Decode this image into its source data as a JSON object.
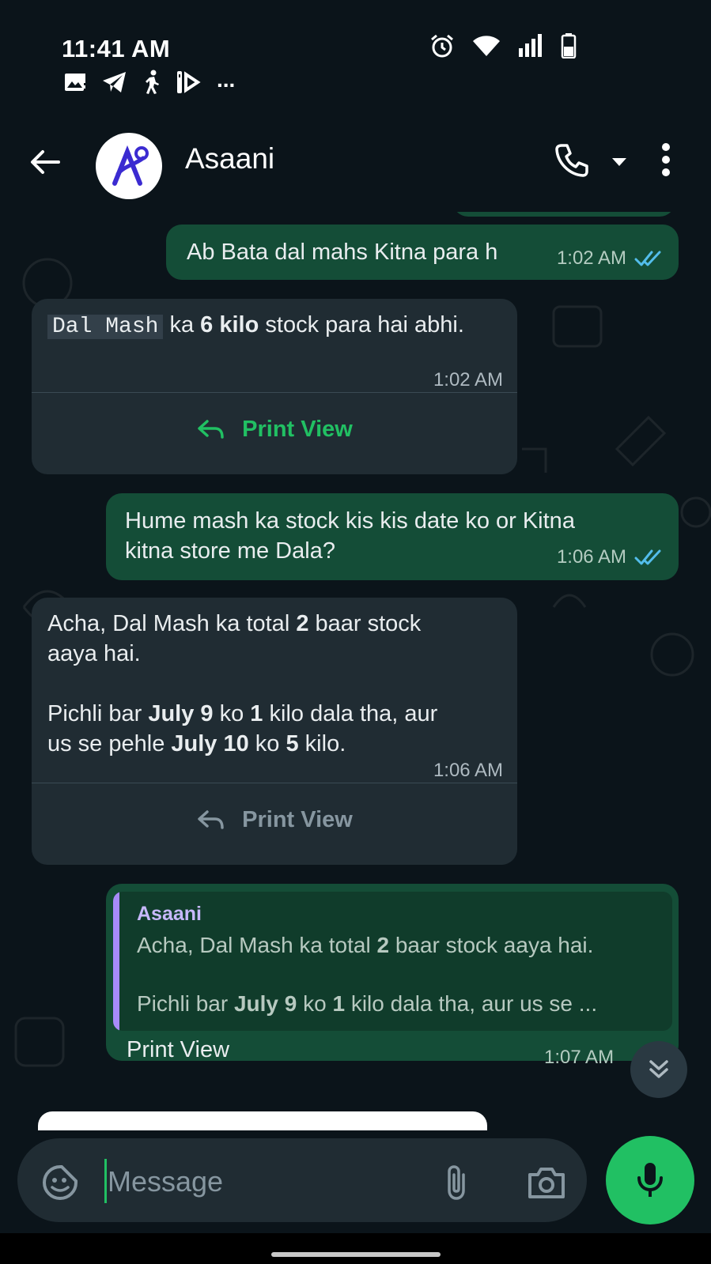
{
  "status_bar": {
    "time": "11:41 AM",
    "overflow_dots": "...",
    "notification_icons": [
      "image-icon",
      "telegram-icon",
      "walking-icon",
      "remote-icon"
    ],
    "system_icons": [
      "alarm-icon",
      "wifi-icon",
      "signal-icon",
      "battery-icon"
    ]
  },
  "header": {
    "title": "Asaani"
  },
  "messages": [
    {
      "direction": "outgoing",
      "text": "Ab Bata dal mahs Kitna para h",
      "time": "1:02 AM",
      "status": "read"
    },
    {
      "direction": "incoming",
      "code": "Dal Mash",
      "text_1": " ka ",
      "bold_1": "6 kilo",
      "text_2": " stock para hai abhi.",
      "time": "1:02 AM",
      "action": "Print View"
    },
    {
      "direction": "outgoing",
      "text_line_1": "Hume mash ka stock kis kis date ko or Kitna",
      "text_line_2": "kitna store me Dala?",
      "time": "1:06 AM",
      "status": "read"
    },
    {
      "direction": "incoming",
      "p1_a": "Acha, Dal Mash ka total ",
      "p1_b": "2",
      "p1_c": " baar stock",
      "p1_d": "aaya hai.",
      "p2_a": "Pichli bar ",
      "p2_b": "July 9",
      "p2_c": " ko ",
      "p2_d": "1",
      "p2_e": " kilo dala tha, aur",
      "p2_f": "us se pehle ",
      "p2_g": "July 10",
      "p2_h": " ko ",
      "p2_i": "5",
      "p2_j": " kilo.",
      "time": "1:06 AM",
      "action": "Print View"
    },
    {
      "direction": "outgoing",
      "quote_author": "Asaani",
      "q1_a": "Acha, Dal Mash ka total ",
      "q1_b": "2",
      "q1_c": " baar stock aaya hai.",
      "q2_a": "Pichli bar ",
      "q2_b": "July 9",
      "q2_c": " ko ",
      "q2_d": "1",
      "q2_e": " kilo dala tha, aur us se ...",
      "text": "Print View",
      "time": "1:07 AM"
    }
  ],
  "composer": {
    "placeholder": "Message"
  },
  "colors": {
    "background": "#0b141a",
    "outgoing_bubble": "#144d37",
    "incoming_bubble": "#202c33",
    "accent": "#21c063",
    "read_ticks": "#53bdeb"
  }
}
